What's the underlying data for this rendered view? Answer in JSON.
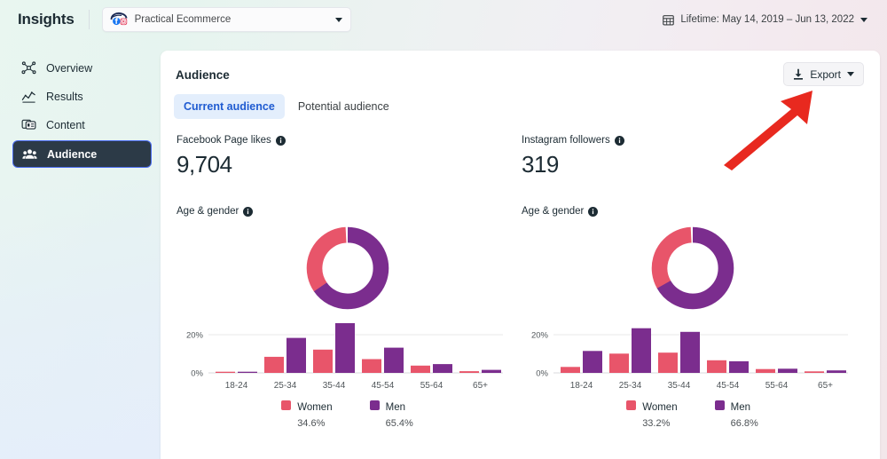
{
  "header": {
    "app_title": "Insights",
    "account_selector": {
      "name": "Practical Ecommerce",
      "logo_icon": "facebook-instagram-logo-icon",
      "caret_icon": "chevron-down-icon"
    },
    "date_range": {
      "calendar_icon": "calendar-icon",
      "label": "Lifetime: May 14, 2019 – Jun 13, 2022",
      "caret_icon": "chevron-down-icon"
    }
  },
  "sidebar": {
    "items": [
      {
        "label": "Overview",
        "icon": "overview-network-icon",
        "active": false
      },
      {
        "label": "Results",
        "icon": "results-linechart-icon",
        "active": false
      },
      {
        "label": "Content",
        "icon": "content-cards-icon",
        "active": false
      },
      {
        "label": "Audience",
        "icon": "audience-people-icon",
        "active": true
      }
    ]
  },
  "main": {
    "title": "Audience",
    "export": {
      "label": "Export",
      "download_icon": "download-icon",
      "caret_icon": "chevron-down-icon"
    },
    "tabs": [
      {
        "label": "Current audience",
        "active": true
      },
      {
        "label": "Potential audience",
        "active": false
      }
    ],
    "columns": [
      {
        "metric_label": "Facebook Page likes",
        "metric_value": "9,704",
        "info_icon": "info-icon",
        "section_label": "Age & gender",
        "section_info_icon": "info-icon"
      },
      {
        "metric_label": "Instagram followers",
        "metric_value": "319",
        "info_icon": "info-icon",
        "section_label": "Age & gender",
        "section_info_icon": "info-icon"
      }
    ]
  },
  "annotation": {
    "arrow_icon": "red-arrow-pointing-up-right-icon",
    "color": "#e8291f"
  },
  "colors": {
    "women": "#e8556a",
    "men": "#7b2d8e",
    "accent_blue": "#1f5bd1",
    "sidebar_active_bg": "#2c3a47",
    "sidebar_active_border": "#4a6cf0"
  },
  "chart_data": [
    {
      "type": "pie",
      "id": "facebook-gender-donut",
      "title": "Age & gender",
      "labels": [
        "Women",
        "Men"
      ],
      "values": [
        34.6,
        65.4
      ],
      "value_labels": [
        "34.6%",
        "65.4%"
      ],
      "colors": [
        "#e8556a",
        "#7b2d8e"
      ],
      "legend": "bottom",
      "donut": true
    },
    {
      "type": "bar",
      "id": "facebook-age-gender-bars",
      "title": "Age & gender",
      "categories": [
        "18-24",
        "25-34",
        "35-44",
        "45-54",
        "55-64",
        "65+"
      ],
      "series": [
        {
          "name": "Women",
          "color": "#e8556a",
          "values": [
            0.6,
            8.4,
            12.2,
            7.2,
            3.8,
            0.9
          ]
        },
        {
          "name": "Men",
          "color": "#7b2d8e",
          "values": [
            0.6,
            18.3,
            26.1,
            13.2,
            4.6,
            1.6
          ]
        }
      ],
      "ylabel": "",
      "xlabel": "",
      "ylim": [
        0,
        28
      ],
      "yticks": [
        0,
        20
      ],
      "ytick_labels": [
        "0%",
        "20%"
      ],
      "grid": true,
      "legend": "bottom"
    },
    {
      "type": "pie",
      "id": "instagram-gender-donut",
      "title": "Age & gender",
      "labels": [
        "Women",
        "Men"
      ],
      "values": [
        33.2,
        66.8
      ],
      "value_labels": [
        "33.2%",
        "66.8%"
      ],
      "colors": [
        "#e8556a",
        "#7b2d8e"
      ],
      "legend": "bottom",
      "donut": true
    },
    {
      "type": "bar",
      "id": "instagram-age-gender-bars",
      "title": "Age & gender",
      "categories": [
        "18-24",
        "25-34",
        "35-44",
        "45-54",
        "55-64",
        "65+"
      ],
      "series": [
        {
          "name": "Women",
          "color": "#e8556a",
          "values": [
            3.1,
            10.1,
            10.6,
            6.6,
            2.0,
            0.8
          ]
        },
        {
          "name": "Men",
          "color": "#7b2d8e",
          "values": [
            11.5,
            23.4,
            21.5,
            6.1,
            2.2,
            1.3
          ]
        }
      ],
      "ylabel": "",
      "xlabel": "",
      "ylim": [
        0,
        28
      ],
      "yticks": [
        0,
        20
      ],
      "ytick_labels": [
        "0%",
        "20%"
      ],
      "grid": true,
      "legend": "bottom"
    }
  ]
}
